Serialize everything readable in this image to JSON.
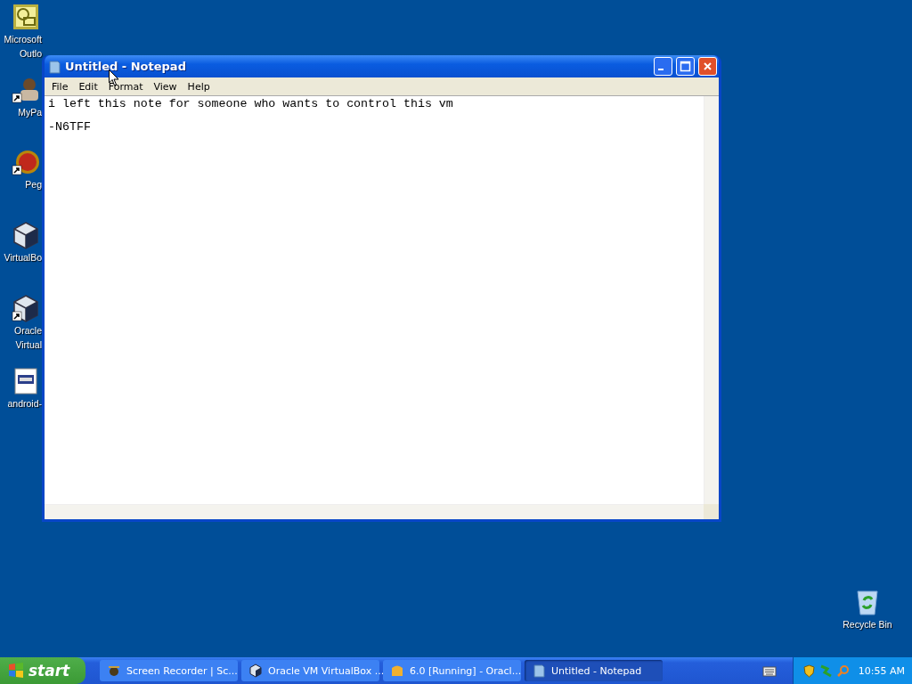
{
  "desktop_icons": [
    {
      "kind": "outlook",
      "shortcut": false,
      "label": [
        "Microsoft",
        "Outlo"
      ]
    },
    {
      "kind": "figure",
      "shortcut": true,
      "label": [
        "MyPa"
      ]
    },
    {
      "kind": "ball",
      "shortcut": true,
      "label": [
        "Peg"
      ]
    },
    {
      "kind": "cube",
      "shortcut": false,
      "label": [
        "VirtualBo"
      ]
    },
    {
      "kind": "cube",
      "shortcut": true,
      "label": [
        "Oracle",
        "Virtual"
      ]
    },
    {
      "kind": "document",
      "shortcut": false,
      "label": [
        "android-"
      ]
    }
  ],
  "recycle_bin": {
    "label": "Recycle Bin"
  },
  "window": {
    "title": "Untitled - Notepad",
    "menu": [
      "File",
      "Edit",
      "Format",
      "View",
      "Help"
    ],
    "text_lines": [
      "i left this note for someone who wants to control this vm",
      "-N6TFF"
    ]
  },
  "taskbar": {
    "start": "start",
    "tasks": [
      {
        "kind": "recorder",
        "label": "Screen Recorder | Sc...",
        "selected": false
      },
      {
        "kind": "cube",
        "label": "Oracle VM VirtualBox ...",
        "selected": false
      },
      {
        "kind": "folder",
        "label": "6.0 [Running] - Oracl...",
        "selected": false
      },
      {
        "kind": "notepad",
        "label": "Untitled - Notepad",
        "selected": true
      }
    ],
    "clock": "10:55 AM"
  }
}
